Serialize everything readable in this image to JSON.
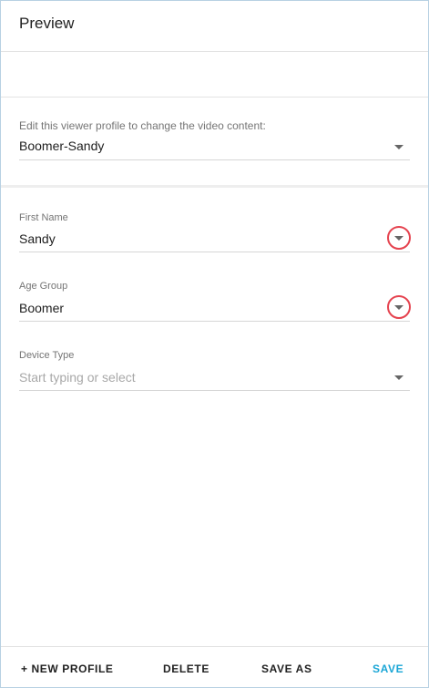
{
  "header": {
    "title": "Preview"
  },
  "profile_selector": {
    "label": "Edit this viewer profile to change the video content:",
    "value": "Boomer-Sandy"
  },
  "fields": {
    "first_name": {
      "label": "First Name",
      "value": "Sandy"
    },
    "age_group": {
      "label": "Age Group",
      "value": "Boomer"
    },
    "device_type": {
      "label": "Device Type",
      "placeholder": "Start typing or select"
    }
  },
  "footer": {
    "new_profile": "+ NEW PROFILE",
    "delete": "DELETE",
    "save_as": "SAVE AS",
    "save": "SAVE"
  },
  "colors": {
    "accent": "#1aa6d6",
    "highlight": "#e5434f",
    "panel_border": "#b7d1e3"
  }
}
